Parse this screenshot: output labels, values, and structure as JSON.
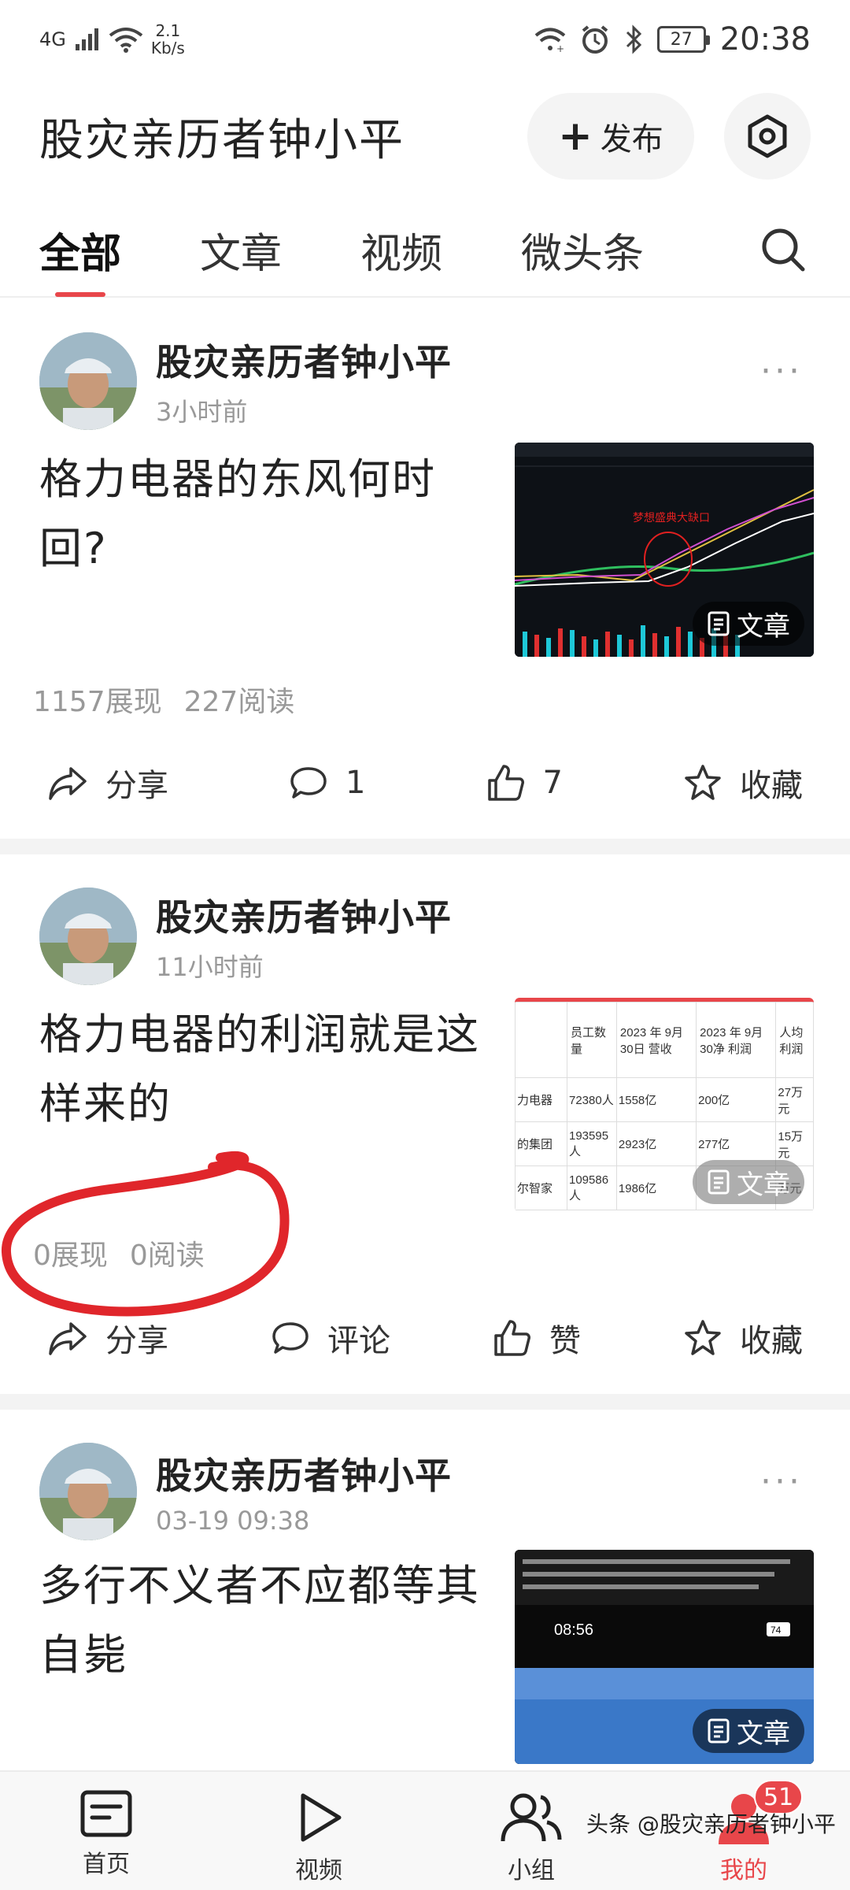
{
  "status_bar": {
    "network": "4G",
    "speed_value": "2.1",
    "speed_unit": "Kb/s",
    "battery": "27",
    "time": "20:38"
  },
  "header": {
    "title": "股灾亲历者钟小平",
    "publish_label": "发布"
  },
  "tabs": [
    {
      "label": "全部",
      "active": true
    },
    {
      "label": "文章",
      "active": false
    },
    {
      "label": "视频",
      "active": false
    },
    {
      "label": "微头条",
      "active": false
    }
  ],
  "posts": [
    {
      "author": "股灾亲历者钟小平",
      "time": "3小时前",
      "title": "格力电器的东风何时回?",
      "badge": "文章",
      "thumb_caption": "梦想盛典大缺口",
      "stats": {
        "impressions": "1157展现",
        "reads": "227阅读"
      },
      "actions": {
        "share": "分享",
        "comment": "1",
        "like": "7",
        "favorite": "收藏"
      }
    },
    {
      "author": "股灾亲历者钟小平",
      "time": "11小时前",
      "title": "格力电器的利润就是这样来的",
      "badge": "文章",
      "table": {
        "headers": [
          "员工数量",
          "2023 年 9月30日 营收",
          "2023 年 9月30净 利润",
          "人均利润"
        ],
        "rows": [
          [
            "力电器",
            "72380人",
            "1558亿",
            "200亿",
            "27万元"
          ],
          [
            "的集团",
            "193595人",
            "2923亿",
            "277亿",
            "15万元"
          ],
          [
            "尔智家",
            "109586人",
            "1986亿",
            "",
            "万元"
          ]
        ]
      },
      "stats": {
        "impressions": "0展现",
        "reads": "0阅读"
      },
      "actions": {
        "share": "分享",
        "comment": "评论",
        "like": "赞",
        "favorite": "收藏"
      }
    },
    {
      "author": "股灾亲历者钟小平",
      "time": "03-19 09:38",
      "title": "多行不义者不应都等其自毙",
      "badge": "文章",
      "phone_time": "08:56",
      "phone_battery": "74"
    }
  ],
  "bottom_nav": [
    {
      "label": "首页"
    },
    {
      "label": "视频"
    },
    {
      "label": "小组"
    },
    {
      "label": "我的",
      "badge": "51"
    }
  ],
  "watermark": "头条 @股灾亲历者钟小平",
  "colors": {
    "accent": "#e8464a",
    "muted": "#999999"
  }
}
